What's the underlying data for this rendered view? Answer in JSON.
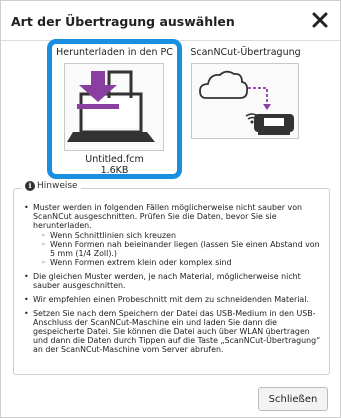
{
  "dialog": {
    "title": "Art der Übertragung auswählen",
    "close_icon": "close-x-icon"
  },
  "options": [
    {
      "label": "Herunterladen in den PC",
      "icon": "download-to-pc-icon",
      "file_name": "Untitled.fcm",
      "file_size": "1.6KB",
      "selected": true
    },
    {
      "label": "ScanNCut-Übertragung",
      "icon": "cloud-to-scanncut-icon",
      "selected": false
    }
  ],
  "hints": {
    "legend": "Hinweise",
    "icon": "info-icon",
    "item1": "Muster werden in folgenden Fällen möglicherweise nicht sauber von ScanNCut ausgeschnitten. Prüfen Sie die Daten, bevor Sie sie herunterladen.",
    "item1_sub1": "Wenn Schnittlinien sich kreuzen",
    "item1_sub2": "Wenn Formen nah beieinander liegen (lassen Sie einen Abstand von 5 mm (1/4 Zoll).)",
    "item1_sub3": "Wenn Formen extrem klein oder komplex sind",
    "item2": "Die gleichen Muster werden, je nach Material, möglicherweise nicht sauber ausgeschnitten.",
    "item3": "Wir empfehlen einen Probeschnitt mit dem zu schneidenden Material.",
    "item4": "Setzen Sie nach dem Speichern der Datei das USB-Medium in den USB-Anschluss der ScanNCut-Maschine ein und laden Sie dann die gespeicherte Datei. Sie können die Datei auch über WLAN übertragen und dann die Daten durch Tippen auf die Taste „ScanNCut-Übertragung“ an der ScanNCut-Maschine vom Server abrufen."
  },
  "footer": {
    "close_label": "Schließen"
  },
  "colors": {
    "selection_border": "#1a8ee0",
    "accent_purple": "#8a3ea0",
    "device_dark": "#333333"
  }
}
